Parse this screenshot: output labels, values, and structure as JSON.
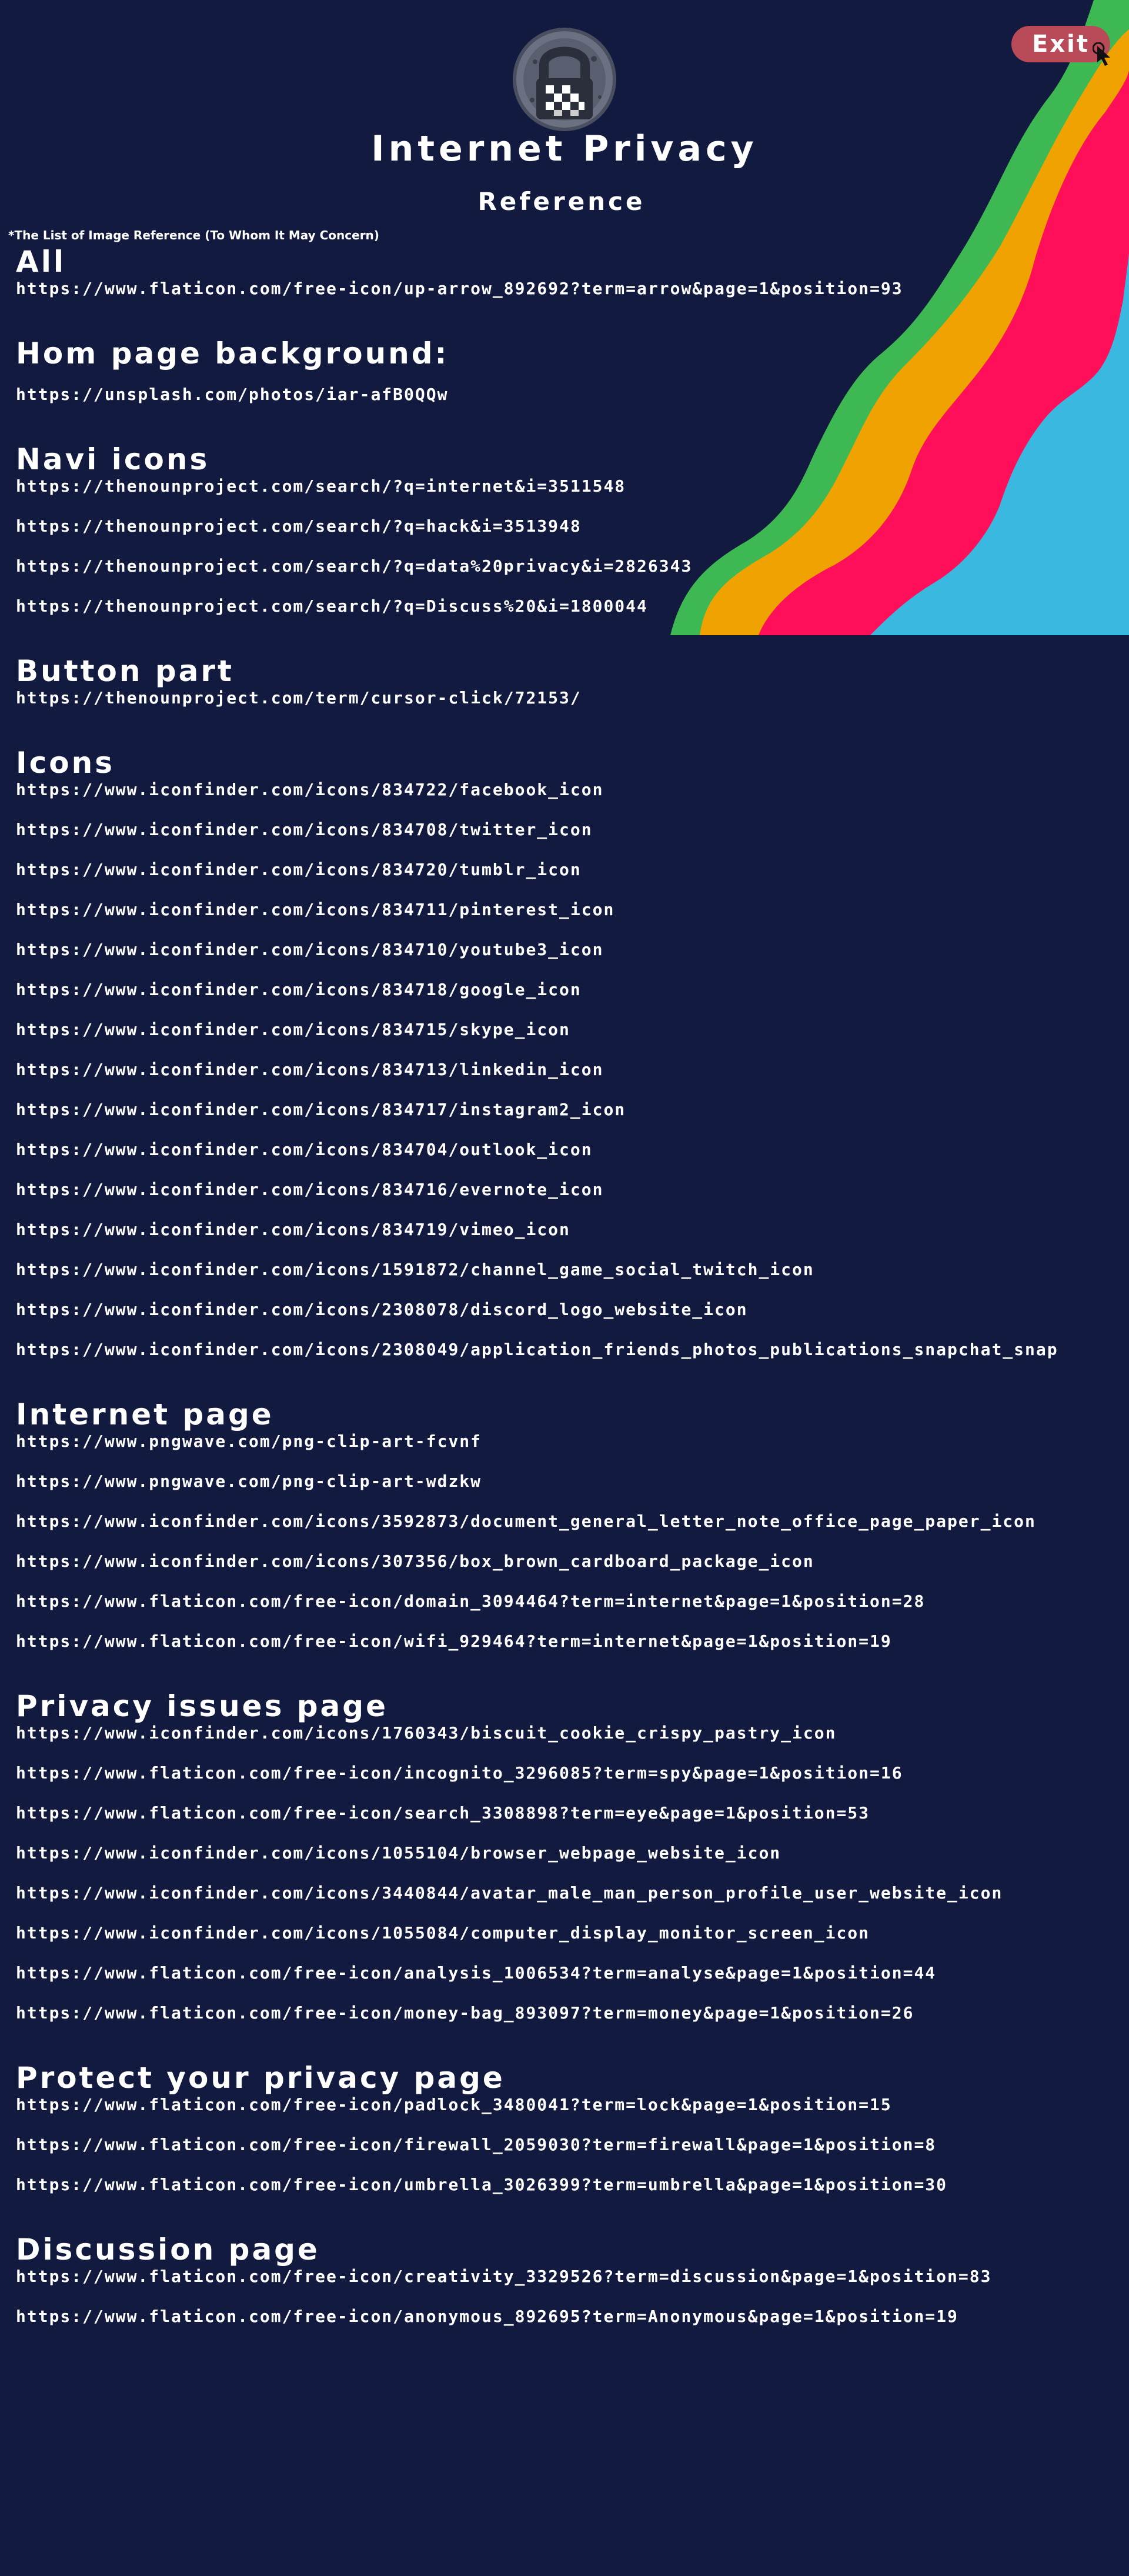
{
  "header": {
    "site_title": "Internet Privacy",
    "page_title": "Reference",
    "exit_label": "Exit",
    "note": "*The List of Image Reference (To Whom It May Concern)"
  },
  "colors": {
    "background": "#131a40",
    "wave_green": "#3db852",
    "wave_orange": "#f0a300",
    "wave_pink": "#ff0f5a",
    "wave_blue": "#3ab8e0",
    "exit_button": "#b94a57"
  },
  "sections": [
    {
      "heading": "All",
      "links": [
        "https://www.flaticon.com/free-icon/up-arrow_892692?term=arrow&page=1&position=93"
      ]
    },
    {
      "heading": "Hom page background:",
      "links": [
        "https://unsplash.com/photos/iar-afB0QQw"
      ]
    },
    {
      "heading": "Navi icons",
      "links": [
        "https://thenounproject.com/search/?q=internet&i=3511548",
        "https://thenounproject.com/search/?q=hack&i=3513948",
        "https://thenounproject.com/search/?q=data%20privacy&i=2826343",
        "https://thenounproject.com/search/?q=Discuss%20&i=1800044"
      ]
    },
    {
      "heading": "Button part",
      "links": [
        "https://thenounproject.com/term/cursor-click/72153/"
      ]
    },
    {
      "heading": "Icons",
      "links": [
        "https://www.iconfinder.com/icons/834722/facebook_icon",
        "https://www.iconfinder.com/icons/834708/twitter_icon",
        "https://www.iconfinder.com/icons/834720/tumblr_icon",
        "https://www.iconfinder.com/icons/834711/pinterest_icon",
        "https://www.iconfinder.com/icons/834710/youtube3_icon",
        "https://www.iconfinder.com/icons/834718/google_icon",
        "https://www.iconfinder.com/icons/834715/skype_icon",
        "https://www.iconfinder.com/icons/834713/linkedin_icon",
        "https://www.iconfinder.com/icons/834717/instagram2_icon",
        "https://www.iconfinder.com/icons/834704/outlook_icon",
        "https://www.iconfinder.com/icons/834716/evernote_icon",
        "https://www.iconfinder.com/icons/834719/vimeo_icon",
        "https://www.iconfinder.com/icons/1591872/channel_game_social_twitch_icon",
        "https://www.iconfinder.com/icons/2308078/discord_logo_website_icon",
        "https://www.iconfinder.com/icons/2308049/application_friends_photos_publications_snapchat_snap"
      ]
    },
    {
      "heading": "Internet page",
      "links": [
        "https://www.pngwave.com/png-clip-art-fcvnf",
        "https://www.pngwave.com/png-clip-art-wdzkw",
        "https://www.iconfinder.com/icons/3592873/document_general_letter_note_office_page_paper_icon",
        "https://www.iconfinder.com/icons/307356/box_brown_cardboard_package_icon",
        "https://www.flaticon.com/free-icon/domain_3094464?term=internet&page=1&position=28",
        "https://www.flaticon.com/free-icon/wifi_929464?term=internet&page=1&position=19"
      ]
    },
    {
      "heading": "Privacy issues page",
      "links": [
        "https://www.iconfinder.com/icons/1760343/biscuit_cookie_crispy_pastry_icon",
        "https://www.flaticon.com/free-icon/incognito_3296085?term=spy&page=1&position=16",
        "https://www.flaticon.com/free-icon/search_3308898?term=eye&page=1&position=53",
        "https://www.iconfinder.com/icons/1055104/browser_webpage_website_icon",
        "https://www.iconfinder.com/icons/3440844/avatar_male_man_person_profile_user_website_icon",
        "https://www.iconfinder.com/icons/1055084/computer_display_monitor_screen_icon",
        "https://www.flaticon.com/free-icon/analysis_1006534?term=analyse&page=1&position=44",
        "https://www.flaticon.com/free-icon/money-bag_893097?term=money&page=1&position=26"
      ]
    },
    {
      "heading": "Protect your privacy page",
      "links": [
        "https://www.flaticon.com/free-icon/padlock_3480041?term=lock&page=1&position=15",
        "https://www.flaticon.com/free-icon/firewall_2059030?term=firewall&page=1&position=8",
        "https://www.flaticon.com/free-icon/umbrella_3026399?term=umbrella&page=1&position=30"
      ]
    },
    {
      "heading": "Discussion page",
      "links": [
        "https://www.flaticon.com/free-icon/creativity_3329526?term=discussion&page=1&position=83",
        "https://www.flaticon.com/free-icon/anonymous_892695?term=Anonymous&page=1&position=19"
      ]
    }
  ]
}
